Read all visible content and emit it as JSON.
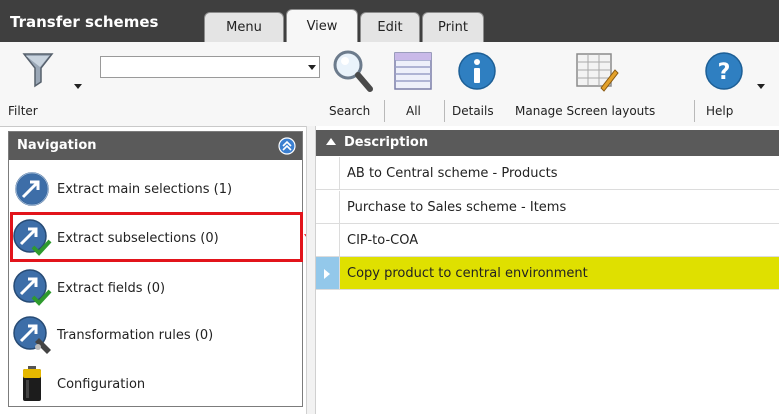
{
  "app": {
    "title": "Transfer schemes"
  },
  "tabs": [
    {
      "label": "Menu"
    },
    {
      "label": "View"
    },
    {
      "label": "Edit"
    },
    {
      "label": "Print"
    }
  ],
  "ribbon": {
    "filter_label": "Filter",
    "filter_value": "",
    "search_label": "Search",
    "all_label": "All",
    "details_label": "Details",
    "manage_label": "Manage Screen layouts",
    "help_label": "Help"
  },
  "navigation": {
    "title": "Navigation",
    "items": [
      {
        "label": "Extract main selections (1)",
        "icon": "extract-main-icon"
      },
      {
        "label": "Extract subselections (0)",
        "icon": "extract-sub-check-icon"
      },
      {
        "label": "Extract fields (0)",
        "icon": "extract-fields-check-icon"
      },
      {
        "label": "Transformation rules (0)",
        "icon": "transformation-rules-icon"
      },
      {
        "label": "Configuration",
        "icon": "battery-icon"
      }
    ]
  },
  "grid": {
    "column_header": "Description",
    "rows": [
      {
        "description": "AB to Central scheme - Products"
      },
      {
        "description": "Purchase to Sales scheme - Items"
      },
      {
        "description": "CIP-to-COA"
      },
      {
        "description": "Copy product to central environment"
      }
    ]
  },
  "colors": {
    "title_bar": "#3f3f3f",
    "header": "#5a5a5a",
    "selected_row": "#dfe000",
    "annotation": "#e2141b"
  }
}
